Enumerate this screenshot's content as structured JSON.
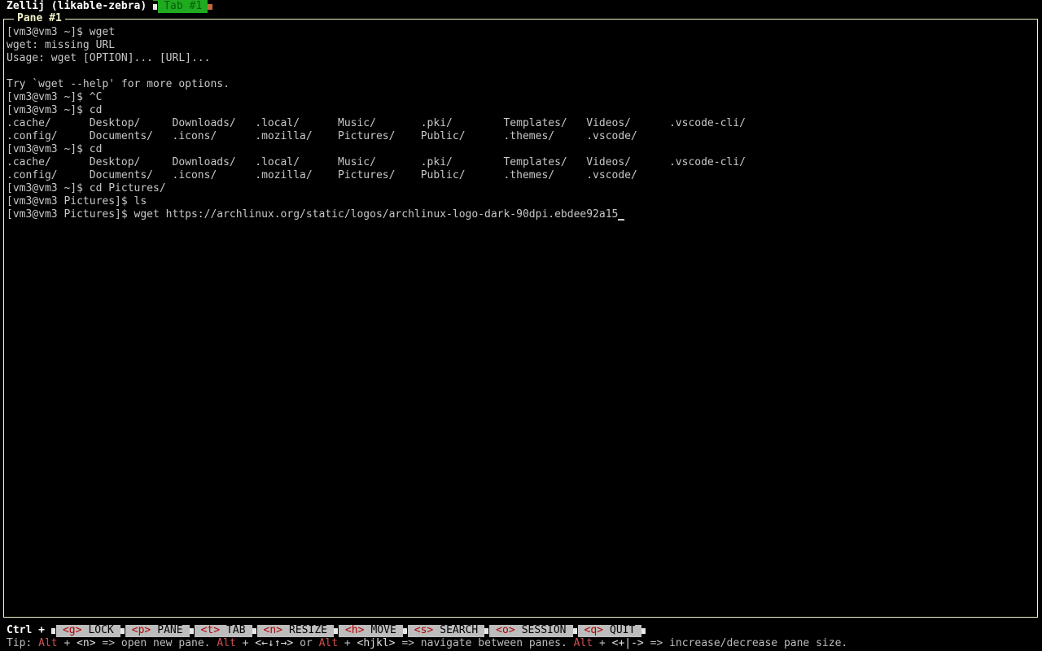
{
  "topbar": {
    "session_title": "Zellij (likable-zebra)",
    "active_tab": "Tab #1"
  },
  "pane": {
    "title": "Pane #1"
  },
  "terminal": {
    "lines": [
      "[vm3@vm3 ~]$ wget",
      "wget: missing URL",
      "Usage: wget [OPTION]... [URL]...",
      "",
      "Try `wget --help' for more options.",
      "[vm3@vm3 ~]$ ^C",
      "[vm3@vm3 ~]$ cd",
      ".cache/      Desktop/     Downloads/   .local/      Music/       .pki/        Templates/   Videos/      .vscode-cli/",
      ".config/     Documents/   .icons/      .mozilla/    Pictures/    Public/      .themes/     .vscode/",
      "[vm3@vm3 ~]$ cd",
      ".cache/      Desktop/     Downloads/   .local/      Music/       .pki/        Templates/   Videos/      .vscode-cli/",
      ".config/     Documents/   .icons/      .mozilla/    Pictures/    Public/      .themes/     .vscode/",
      "[vm3@vm3 ~]$ cd Pictures/",
      "[vm3@vm3 Pictures]$ ls",
      "[vm3@vm3 Pictures]$ wget https://archlinux.org/static/logos/archlinux-logo-dark-90dpi.ebdee92a15"
    ]
  },
  "modebar": {
    "ctrl_label": "Ctrl +",
    "items": [
      {
        "key": "<g>",
        "label": "LOCK"
      },
      {
        "key": "<p>",
        "label": "PANE"
      },
      {
        "key": "<t>",
        "label": "TAB"
      },
      {
        "key": "<n>",
        "label": "RESIZE"
      },
      {
        "key": "<h>",
        "label": "MOVE"
      },
      {
        "key": "<s>",
        "label": "SEARCH"
      },
      {
        "key": "<o>",
        "label": "SESSION"
      },
      {
        "key": "<q>",
        "label": "QUIT"
      }
    ]
  },
  "tip": {
    "prefix": "Tip: ",
    "alt1": "Alt",
    "plus1": " + ",
    "key1": "<n>",
    "text1": " => open new pane. ",
    "alt2": "Alt",
    "plus2": " + ",
    "key2": "<←↓↑→>",
    "or": " or ",
    "alt3": "Alt",
    "plus3": " + ",
    "key3": "<hjkl>",
    "text2": " => navigate between panes. ",
    "alt4": "Alt",
    "plus4": " + ",
    "key4": "<+|->",
    "text3": " => increase/decrease pane size."
  },
  "colors": {
    "tab_active_bg": "#1faa1f",
    "pane_border": "#f2f2c8",
    "modebar_bg": "#bdbdbd",
    "key_red": "#b00000",
    "tip_red": "#d05050"
  }
}
